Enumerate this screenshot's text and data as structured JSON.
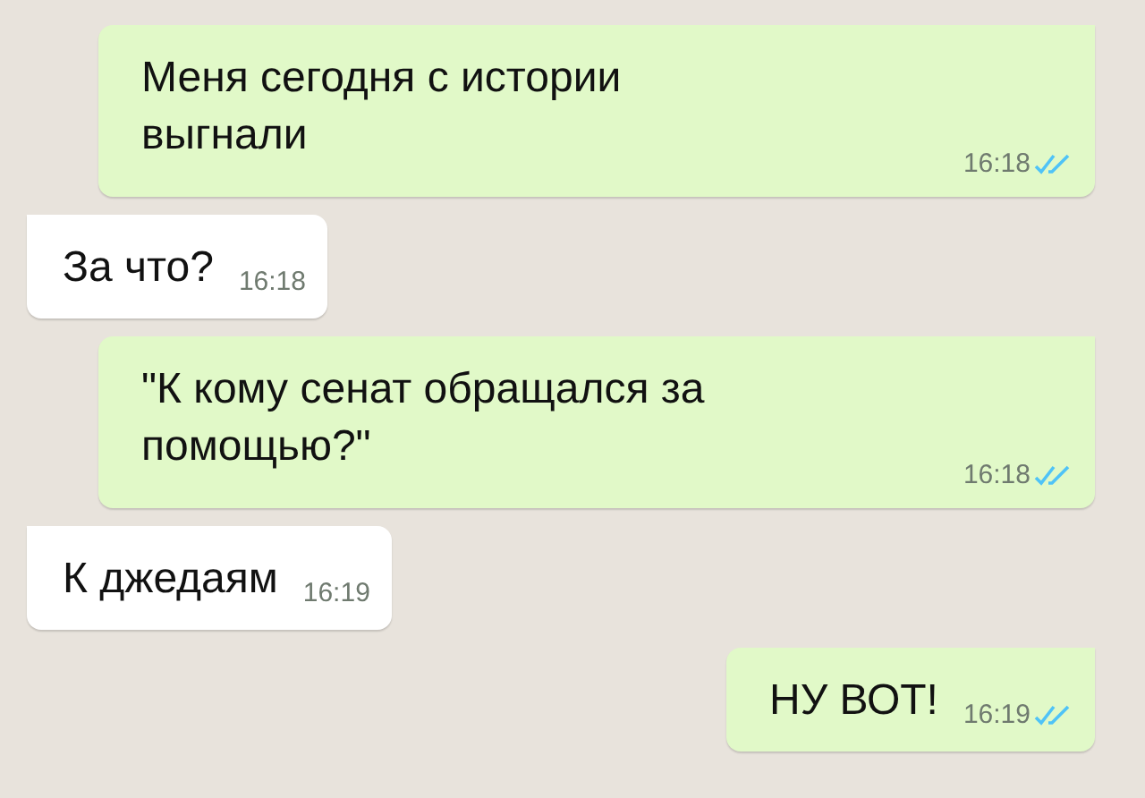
{
  "messages": [
    {
      "kind": "outgoing",
      "text": "Меня сегодня с истории выгнали",
      "time": "16:18",
      "read": true
    },
    {
      "kind": "incoming",
      "text": "За что?",
      "time": "16:18"
    },
    {
      "kind": "outgoing",
      "text": "\"К кому сенат обращался за помощью?\"",
      "time": "16:18",
      "read": true
    },
    {
      "kind": "incoming",
      "text": "К джедаям",
      "time": "16:19"
    },
    {
      "kind": "outgoing",
      "text": "НУ ВОТ!",
      "time": "16:19",
      "read": true
    }
  ]
}
